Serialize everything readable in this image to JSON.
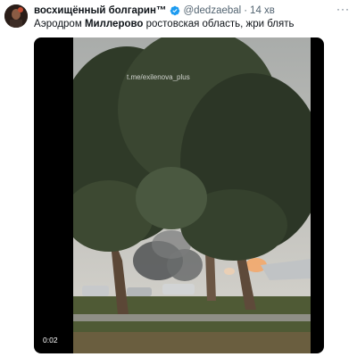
{
  "tweet": {
    "author_name": "восхищённый болгарин™",
    "handle": "@dedzaebal",
    "separator": "·",
    "time": "14 хв",
    "more": "···",
    "text_parts": [
      "Аэродром ",
      "Миллерово",
      " ростовская область, жри блять"
    ]
  },
  "video": {
    "watermark": "t.me/exilenova_plus",
    "duration": "0:02"
  },
  "colors": {
    "verified": "#1d9bf0",
    "secondary_text": "#536471"
  }
}
